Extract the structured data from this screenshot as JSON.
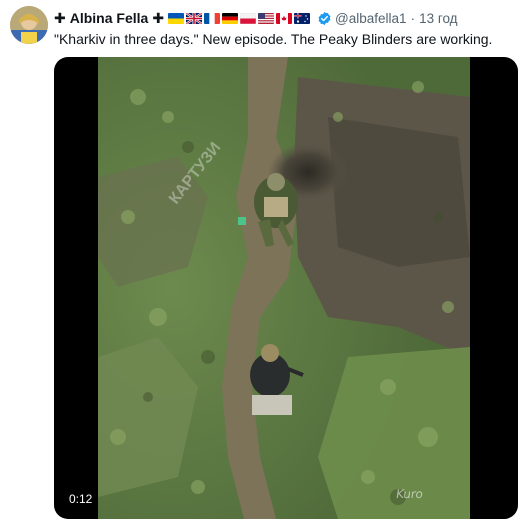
{
  "author": {
    "cross_left": "✚",
    "display_name": "Albina Fella",
    "cross_right": "✚",
    "flags": [
      "ukraine-flag-icon",
      "uk-flag-icon",
      "france-flag-icon",
      "germany-flag-icon",
      "poland-flag-icon",
      "usa-flag-icon",
      "canada-flag-icon",
      "australia-flag-icon"
    ],
    "handle": "@albafella1",
    "separator": "·",
    "timestamp": "13 год"
  },
  "tweet": {
    "text": "\"Kharkiv in three days.\" New episode. The Peaky Blinders are working."
  },
  "media": {
    "duration": "0:12",
    "watermark_diagonal": "КАРТУЗИ",
    "watermark_corner": "Kuro"
  },
  "colors": {
    "verified": "#1d9bf0",
    "secondary_text": "#536471",
    "primary_text": "#0f1419"
  }
}
